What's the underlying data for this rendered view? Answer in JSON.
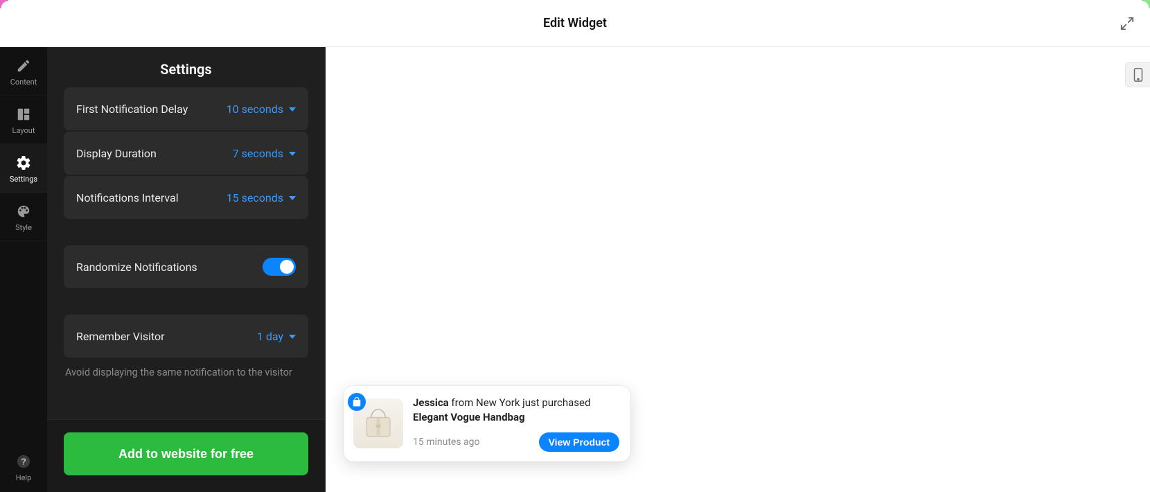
{
  "header": {
    "title": "Edit Widget"
  },
  "nav": {
    "content": "Content",
    "layout": "Layout",
    "settings": "Settings",
    "style": "Style",
    "help": "Help"
  },
  "panel": {
    "title": "Settings",
    "first_delay_label": "First Notification Delay",
    "first_delay_value": "10 seconds",
    "display_duration_label": "Display Duration",
    "display_duration_value": "7 seconds",
    "interval_label": "Notifications Interval",
    "interval_value": "15 seconds",
    "randomize_label": "Randomize Notifications",
    "randomize_on": true,
    "remember_label": "Remember Visitor",
    "remember_value": "1 day",
    "hint": "Avoid displaying the same notification to the visitor",
    "cta": "Add to website for free"
  },
  "notification": {
    "name": "Jessica",
    "middle_text": " from New York just purchased ",
    "product": "Elegant Vogue Handbag",
    "time": "15 minutes ago",
    "button": "View Product"
  },
  "colors": {
    "accent": "#0b84ff",
    "cta": "#2dbb3f"
  }
}
